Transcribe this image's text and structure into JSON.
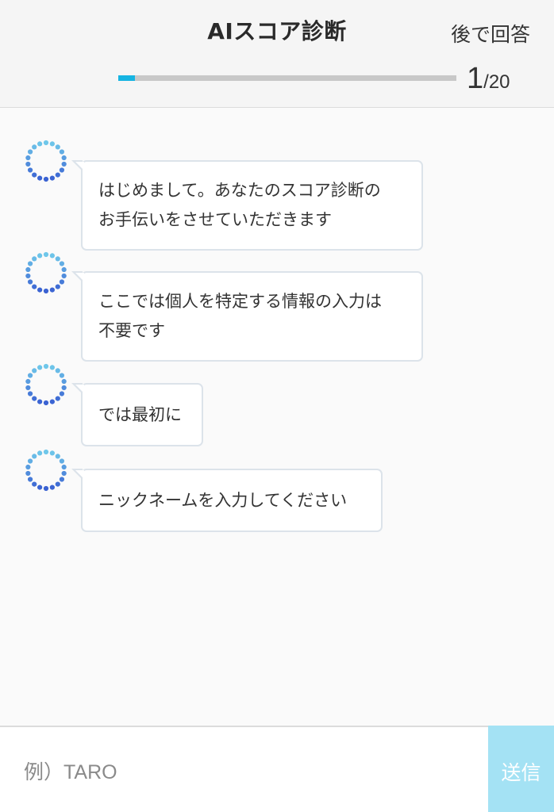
{
  "header": {
    "title": "AIスコア診断",
    "later_label": "後で回答",
    "progress": {
      "current": "1",
      "separator": "/",
      "total": "20",
      "fraction": 0.05,
      "fill_color": "#16b4e2",
      "track_color": "#c8c8c8"
    }
  },
  "chat": {
    "messages": [
      {
        "lines": [
          "はじめまして。あなたのスコア診断の",
          "お手伝いをさせていただきます"
        ]
      },
      {
        "lines": [
          "ここでは個人を特定する情報の入力は",
          "不要です"
        ]
      },
      {
        "lines": [
          "では最初に"
        ]
      },
      {
        "lines": [
          "ニックネームを入力してください"
        ]
      }
    ],
    "avatar_icon": "dotted-ring-avatar-icon"
  },
  "input": {
    "placeholder": "例）TARO",
    "value": "",
    "send_label": "送信",
    "send_color": "#a4e2f4"
  }
}
